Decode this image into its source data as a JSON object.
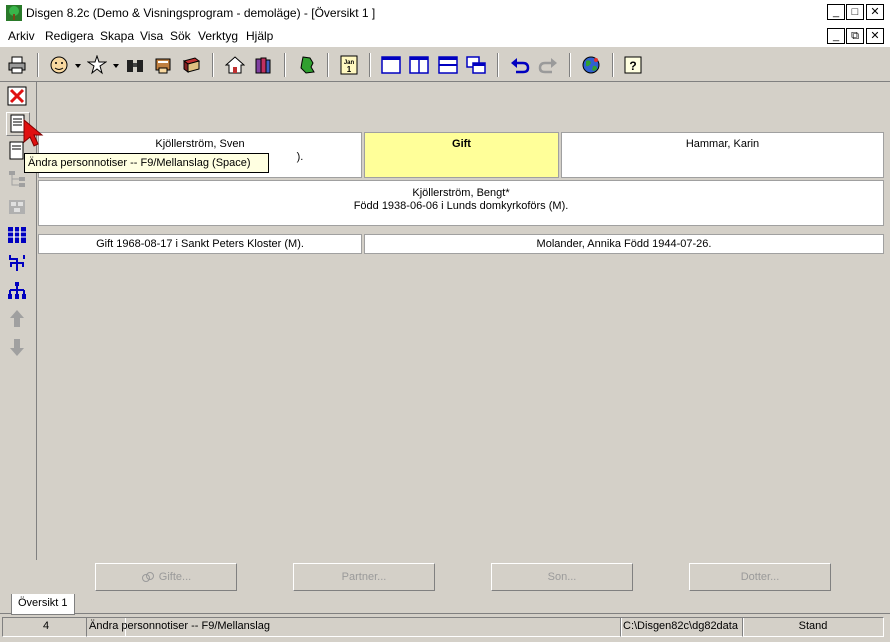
{
  "window": {
    "title": "Disgen 8.2c (Demo & Visningsprogram - demoläge) - [Översikt 1 ]",
    "controls": {
      "minimize": "_",
      "maximize": "□",
      "close": "✕",
      "restore": "⧉"
    }
  },
  "menu": [
    "Arkiv",
    "Redigera",
    "Skapa",
    "Visa",
    "Sök",
    "Verktyg",
    "Hjälp"
  ],
  "tooltip": "Ändra personnotiser -- F9/Mellanslag (Space)",
  "overview": {
    "father": {
      "name": "Kjöllerström, Sven",
      "line2": ")."
    },
    "marriage_label": "Gift",
    "mother": {
      "name": "Hammar, Karin"
    },
    "main_person": {
      "name": "Kjöllerström, Bengt*",
      "birth": "Född 1938-06-06 i Lunds domkyrkoförs (M)."
    },
    "marriage_info": "Gift 1968-08-17 i Sankt Peters Kloster (M).",
    "spouse": "Molander, Annika Född 1944-07-26."
  },
  "nav_buttons": {
    "gifte": "Gifte...",
    "partner": "Partner...",
    "son": "Son...",
    "dotter": "Dotter..."
  },
  "tab": {
    "label": "Översikt 1"
  },
  "status": {
    "count": "4",
    "message": "Ändra personnotiser -- F9/Mellanslag",
    "path": "C:\\Disgen82c\\dg82data",
    "mode": "Stand"
  },
  "toolbar_icons": [
    "print-icon",
    "person-icon",
    "star-person-icon",
    "binoculars-icon",
    "hand-book-icon",
    "book-icon",
    "home-icon",
    "books-icon",
    "map-icon",
    "calendar-icon",
    "window-single-icon",
    "window-split-icon",
    "window-horizontal-icon",
    "window-cascade-icon",
    "undo-icon",
    "redo-icon",
    "globe-icon",
    "help-icon"
  ],
  "calendar_text": {
    "month": "Jan",
    "day": "1"
  },
  "help_text": "?",
  "colors": {
    "marriage_bg": "#ffff99",
    "accent_blue": "#0000c0",
    "toolbar_bg": "#d4d0c8"
  }
}
